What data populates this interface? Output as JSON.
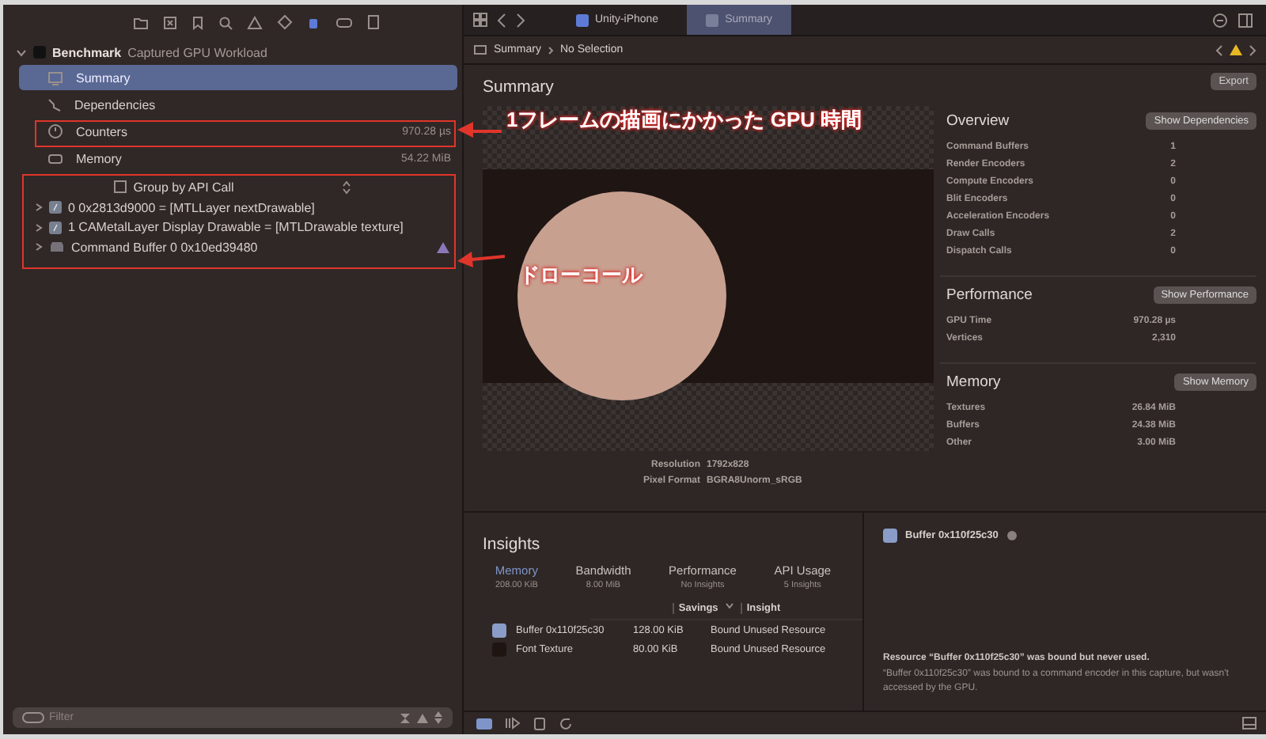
{
  "sidebar": {
    "project": {
      "name": "Benchmark",
      "subtitle": "Captured GPU Workload"
    },
    "nav_items": [
      {
        "kind": "summary",
        "label": "Summary",
        "value": "",
        "selected": true
      },
      {
        "kind": "dependencies",
        "label": "Dependencies",
        "value": "",
        "selected": false
      },
      {
        "kind": "counters",
        "label": "Counters",
        "value": "970.28 µs",
        "selected": false
      },
      {
        "kind": "memory",
        "label": "Memory",
        "value": "54.22 MiB",
        "selected": false
      }
    ],
    "group_selector": "Group by API Call",
    "calls": [
      {
        "kind": "call",
        "label": "0 0x2813d9000 = [MTLLayer nextDrawable]",
        "warning": false
      },
      {
        "kind": "call",
        "label": "1 CAMetalLayer Display Drawable = [MTLDrawable texture]",
        "warning": false
      },
      {
        "kind": "buffer",
        "label": "Command Buffer 0 0x10ed39480",
        "warning": true
      }
    ],
    "filter": {
      "placeholder": "Filter"
    }
  },
  "tabs": [
    {
      "label": "Unity-iPhone",
      "selected": false
    },
    {
      "label": "Summary",
      "selected": true
    }
  ],
  "breadcrumb": [
    "Summary",
    "No Selection"
  ],
  "summary": {
    "title": "Summary",
    "export_button": "Export",
    "image_info": [
      {
        "label": "Resolution",
        "value": "1792x828"
      },
      {
        "label": "Pixel Format",
        "value": "BGRA8Unorm_sRGB"
      }
    ]
  },
  "stats": [
    {
      "title": "Overview",
      "button": "Show Dependencies",
      "rows": [
        [
          "Command Buffers",
          "1"
        ],
        [
          "Render Encoders",
          "2"
        ],
        [
          "Compute Encoders",
          "0"
        ],
        [
          "Blit Encoders",
          "0"
        ],
        [
          "Acceleration Encoders",
          "0"
        ],
        [
          "Draw Calls",
          "2"
        ],
        [
          "Dispatch Calls",
          "0"
        ]
      ]
    },
    {
      "title": "Performance",
      "button": "Show Performance",
      "rows": [
        [
          "GPU Time",
          "970.28 µs"
        ],
        [
          "Vertices",
          "2,310"
        ]
      ]
    },
    {
      "title": "Memory",
      "button": "Show Memory",
      "rows": [
        [
          "Textures",
          "26.84 MiB"
        ],
        [
          "Buffers",
          "24.38 MiB"
        ],
        [
          "Other",
          "3.00 MiB"
        ]
      ]
    }
  ],
  "insights": {
    "title": "Insights",
    "tabs": [
      {
        "label": "Memory",
        "sub": "208.00 KiB",
        "selected": true
      },
      {
        "label": "Bandwidth",
        "sub": "8.00 MiB",
        "selected": false
      },
      {
        "label": "Performance",
        "sub": "No Insights",
        "selected": false
      },
      {
        "label": "API Usage",
        "sub": "5 Insights",
        "selected": false
      }
    ],
    "columns": [
      "Savings",
      "Insight"
    ],
    "rows": [
      {
        "name": "Buffer 0x110f25c30",
        "size": "128.00 KiB",
        "insight": "Bound Unused Resource",
        "color": "#8a9cc8"
      },
      {
        "name": "Font Texture",
        "size": "80.00 KiB",
        "insight": "Bound Unused Resource",
        "color": "#1e1513"
      }
    ]
  },
  "detail": {
    "title": "Buffer 0x110f25c30",
    "heading": "Resource “Buffer 0x110f25c30” was bound but never used.",
    "body": "“Buffer 0x110f25c30” was bound to a command encoder in this capture, but wasn't accessed by the GPU."
  },
  "annotations": [
    {
      "kind": "counters",
      "text": "1フレームの描画にかかった GPU 時間"
    },
    {
      "kind": "calls",
      "text": "ドローコール"
    }
  ]
}
